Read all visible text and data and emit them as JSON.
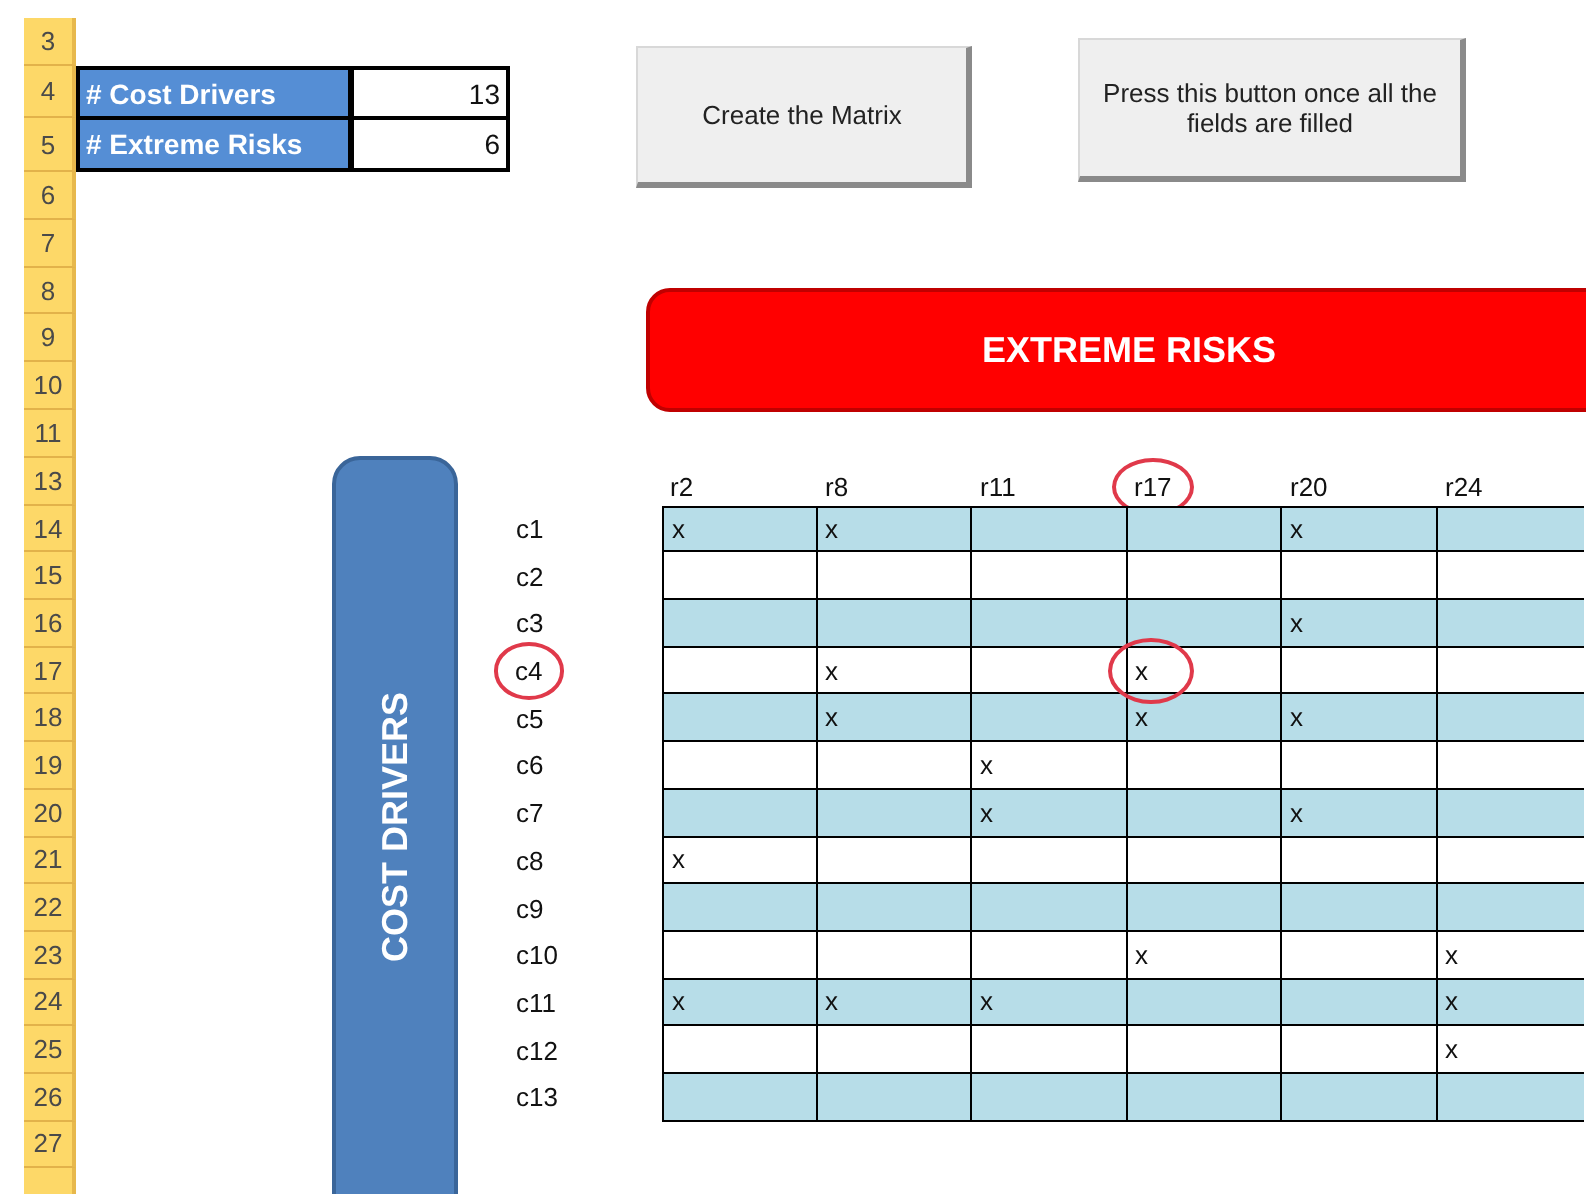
{
  "row_numbers": [
    "3",
    "4",
    "5",
    "6",
    "7",
    "8",
    "9",
    "10",
    "11",
    "13",
    "14",
    "15",
    "16",
    "17",
    "18",
    "19",
    "20",
    "21",
    "22",
    "23",
    "24",
    "25",
    "26",
    "27"
  ],
  "summary": [
    {
      "label": "# Cost Drivers",
      "value": "13"
    },
    {
      "label": "# Extreme Risks",
      "value": "6"
    }
  ],
  "buttons": [
    "Create the Matrix",
    "Press this button once all the  fields are filled"
  ],
  "banner": "EXTREME RISKS",
  "side_label": "COST DRIVERS",
  "matrix": {
    "columns": [
      {
        "label": "r2",
        "circled": false
      },
      {
        "label": "r8",
        "circled": false
      },
      {
        "label": "r11",
        "circled": false
      },
      {
        "label": "r17",
        "circled": true
      },
      {
        "label": "r20",
        "circled": false
      },
      {
        "label": "r24",
        "circled": false
      }
    ],
    "rows": [
      {
        "label": "c1",
        "circled": false,
        "shaded": true,
        "cells": [
          {
            "text": "x",
            "circled": false
          },
          {
            "text": "x",
            "circled": false
          },
          {
            "circled": false
          },
          {
            "circled": false
          },
          {
            "text": "x",
            "circled": false
          },
          {
            "circled": false
          }
        ]
      },
      {
        "label": "c2",
        "circled": false,
        "shaded": false,
        "cells": [
          {
            "circled": false
          },
          {
            "circled": false
          },
          {
            "circled": false
          },
          {
            "circled": false
          },
          {
            "circled": false
          },
          {
            "circled": false
          }
        ]
      },
      {
        "label": "c3",
        "circled": false,
        "shaded": true,
        "cells": [
          {
            "circled": false
          },
          {
            "circled": false
          },
          {
            "circled": false
          },
          {
            "circled": false
          },
          {
            "text": "x",
            "circled": false
          },
          {
            "circled": false
          }
        ]
      },
      {
        "label": "c4",
        "circled": true,
        "shaded": false,
        "cells": [
          {
            "circled": false
          },
          {
            "text": "x",
            "circled": false
          },
          {
            "circled": false
          },
          {
            "text": "x",
            "circled": true
          },
          {
            "circled": false
          },
          {
            "circled": false
          }
        ]
      },
      {
        "label": "c5",
        "circled": false,
        "shaded": true,
        "cells": [
          {
            "circled": false
          },
          {
            "text": "x",
            "circled": false
          },
          {
            "circled": false
          },
          {
            "text": "x",
            "circled": false
          },
          {
            "text": "x",
            "circled": false
          },
          {
            "circled": false
          }
        ]
      },
      {
        "label": "c6",
        "circled": false,
        "shaded": false,
        "cells": [
          {
            "circled": false
          },
          {
            "circled": false
          },
          {
            "text": "x",
            "circled": false
          },
          {
            "circled": false
          },
          {
            "circled": false
          },
          {
            "circled": false
          }
        ]
      },
      {
        "label": "c7",
        "circled": false,
        "shaded": true,
        "cells": [
          {
            "circled": false
          },
          {
            "circled": false
          },
          {
            "text": "x",
            "circled": false
          },
          {
            "circled": false
          },
          {
            "text": "x",
            "circled": false
          },
          {
            "circled": false
          }
        ]
      },
      {
        "label": "c8",
        "circled": false,
        "shaded": false,
        "cells": [
          {
            "text": "x",
            "circled": false
          },
          {
            "circled": false
          },
          {
            "circled": false
          },
          {
            "circled": false
          },
          {
            "circled": false
          },
          {
            "circled": false
          }
        ]
      },
      {
        "label": "c9",
        "circled": false,
        "shaded": true,
        "cells": [
          {
            "circled": false
          },
          {
            "circled": false
          },
          {
            "circled": false
          },
          {
            "circled": false
          },
          {
            "circled": false
          },
          {
            "circled": false
          }
        ]
      },
      {
        "label": "c10",
        "circled": false,
        "shaded": false,
        "cells": [
          {
            "circled": false
          },
          {
            "circled": false
          },
          {
            "circled": false
          },
          {
            "text": "x",
            "circled": false
          },
          {
            "circled": false
          },
          {
            "text": "x",
            "circled": false
          }
        ]
      },
      {
        "label": "c11",
        "circled": false,
        "shaded": true,
        "cells": [
          {
            "text": "x",
            "circled": false
          },
          {
            "text": "x",
            "circled": false
          },
          {
            "text": "x",
            "circled": false
          },
          {
            "circled": false
          },
          {
            "circled": false
          },
          {
            "text": "x",
            "circled": false
          }
        ]
      },
      {
        "label": "c12",
        "circled": false,
        "shaded": false,
        "cells": [
          {
            "circled": false
          },
          {
            "circled": false
          },
          {
            "circled": false
          },
          {
            "circled": false
          },
          {
            "circled": false
          },
          {
            "text": "x",
            "circled": false
          }
        ]
      },
      {
        "label": "c13",
        "circled": false,
        "shaded": true,
        "cells": [
          {
            "circled": false
          },
          {
            "circled": false
          },
          {
            "circled": false
          },
          {
            "circled": false
          },
          {
            "circled": false
          },
          {
            "circled": false
          }
        ]
      }
    ]
  }
}
